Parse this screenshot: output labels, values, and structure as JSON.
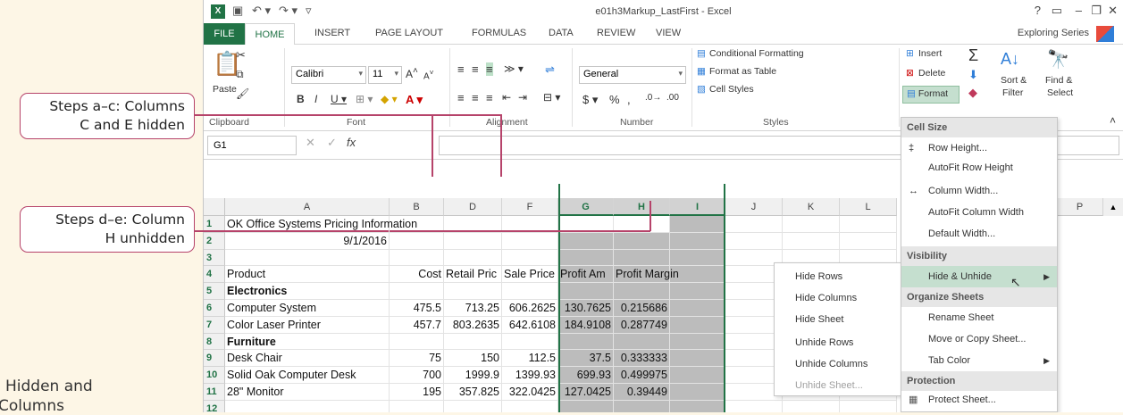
{
  "callouts": {
    "steps_ac_line1": "Steps a–c: Columns",
    "steps_ac_line2": "C and E hidden",
    "steps_de_line1": "Steps d–e: Column",
    "steps_de_line2": "H unhidden"
  },
  "side_caption": {
    "line1": "Hidden and",
    "line2": "Columns"
  },
  "window": {
    "title": "e01h3Markup_LastFirst - Excel",
    "account": "Exploring Series",
    "logo": "X"
  },
  "tabs": [
    "FILE",
    "HOME",
    "INSERT",
    "PAGE LAYOUT",
    "FORMULAS",
    "DATA",
    "REVIEW",
    "VIEW"
  ],
  "ribbon": {
    "paste": "Paste",
    "font_name": "Calibri",
    "font_size": "11",
    "number_format": "General",
    "conditional_formatting": "Conditional Formatting",
    "format_as_table": "Format as Table",
    "cell_styles": "Cell Styles",
    "insert": "Insert",
    "delete": "Delete",
    "format": "Format",
    "sort_filter": "Sort &",
    "sort_filter2": "Filter",
    "find_select": "Find &",
    "find_select2": "Select",
    "groups": {
      "clipboard": "Clipboard",
      "font": "Font",
      "alignment": "Alignment",
      "number": "Number",
      "styles": "Styles"
    }
  },
  "formula_bar": {
    "name_box": "G1",
    "fx": "fx"
  },
  "columns": [
    "A",
    "B",
    "D",
    "F",
    "G",
    "H",
    "I",
    "J",
    "K",
    "L",
    "P"
  ],
  "rows": [
    {
      "n": "1",
      "a": "OK Office Systems Pricing Information",
      "b": "",
      "d": "",
      "f": "",
      "g": "",
      "h": "",
      "bold": false
    },
    {
      "n": "2",
      "a": "9/1/2016",
      "b": "",
      "d": "",
      "f": "",
      "g": "",
      "h": "",
      "bold": false
    },
    {
      "n": "3",
      "a": "",
      "b": "",
      "d": "",
      "f": "",
      "g": "",
      "h": "",
      "bold": false
    },
    {
      "n": "4",
      "a": "Product",
      "b": "Cost",
      "d": "Retail Pric",
      "f": "Sale Price",
      "g": "Profit Am",
      "h": "Profit Margin",
      "bold": false
    },
    {
      "n": "5",
      "a": "Electronics",
      "b": "",
      "d": "",
      "f": "",
      "g": "",
      "h": "",
      "bold": true
    },
    {
      "n": "6",
      "a": "Computer System",
      "b": "475.5",
      "d": "713.25",
      "f": "606.2625",
      "g": "130.7625",
      "h": "0.215686",
      "bold": false
    },
    {
      "n": "7",
      "a": "Color Laser Printer",
      "b": "457.7",
      "d": "803.2635",
      "f": "642.6108",
      "g": "184.9108",
      "h": "0.287749",
      "bold": false
    },
    {
      "n": "8",
      "a": "Furniture",
      "b": "",
      "d": "",
      "f": "",
      "g": "",
      "h": "",
      "bold": true
    },
    {
      "n": "9",
      "a": "Desk Chair",
      "b": "75",
      "d": "150",
      "f": "112.5",
      "g": "37.5",
      "h": "0.333333",
      "bold": false
    },
    {
      "n": "10",
      "a": "Solid Oak Computer Desk",
      "b": "700",
      "d": "1999.9",
      "f": "1399.93",
      "g": "699.93",
      "h": "0.499975",
      "bold": false
    },
    {
      "n": "11",
      "a": "28\" Monitor",
      "b": "195",
      "d": "357.825",
      "f": "322.0425",
      "g": "127.0425",
      "h": "0.39449",
      "bold": false
    },
    {
      "n": "12",
      "a": "",
      "b": "",
      "d": "",
      "f": "",
      "g": "",
      "h": "",
      "bold": false
    }
  ],
  "format_menu": {
    "cell_size": "Cell Size",
    "row_height": "Row Height...",
    "autofit_row": "AutoFit Row Height",
    "column_width": "Column Width...",
    "autofit_col": "AutoFit Column Width",
    "default_width": "Default Width...",
    "visibility": "Visibility",
    "hide_unhide": "Hide & Unhide",
    "organize": "Organize Sheets",
    "rename": "Rename Sheet",
    "move_copy": "Move or Copy Sheet...",
    "tab_color": "Tab Color",
    "protection": "Protection",
    "protect": "Protect Sheet..."
  },
  "hide_submenu": {
    "hide_rows": "Hide Rows",
    "hide_columns": "Hide Columns",
    "hide_sheet": "Hide Sheet",
    "unhide_rows": "Unhide Rows",
    "unhide_columns": "Unhide Columns",
    "unhide_sheet": "Unhide Sheet..."
  },
  "colors": {
    "excel_green": "#217346",
    "callout_border": "#b6436a",
    "selection_shade": "#bcbcbc"
  }
}
